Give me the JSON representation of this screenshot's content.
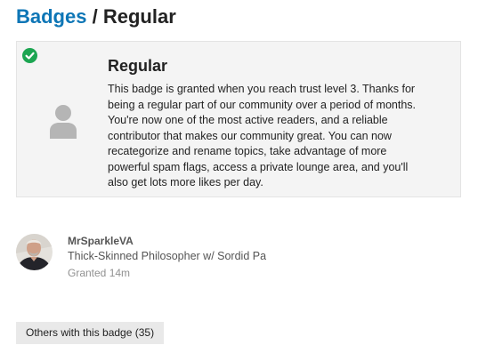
{
  "colors": {
    "link": "#0e76b6",
    "check": "#1ca551",
    "card_background": "#f4f4f4",
    "badge_icon": "#b5b5b5",
    "button_background": "#e9e9e9"
  },
  "breadcrumb": {
    "parent_label": "Badges",
    "separator": "/",
    "current_label": "Regular"
  },
  "badge": {
    "granted_check_icon": "check-circle-icon",
    "icon": "user-icon",
    "name": "Regular",
    "description": "This badge is granted when you reach trust level 3. Thanks for being a regular part of our community over a period of months. You're now one of the most active readers, and a reliable contributor that makes our community great. You can now recategorize and rename topics, take advantage of more powerful spam flags, access a private lounge area, and you'll also get lots more likes per day."
  },
  "grants": [
    {
      "username": "MrSparkleVA",
      "title": "Thick-Skinned Philosopher w/ Sordid Pa",
      "granted": "Granted 14m"
    }
  ],
  "others_button": {
    "label": "Others with this badge (35)"
  }
}
